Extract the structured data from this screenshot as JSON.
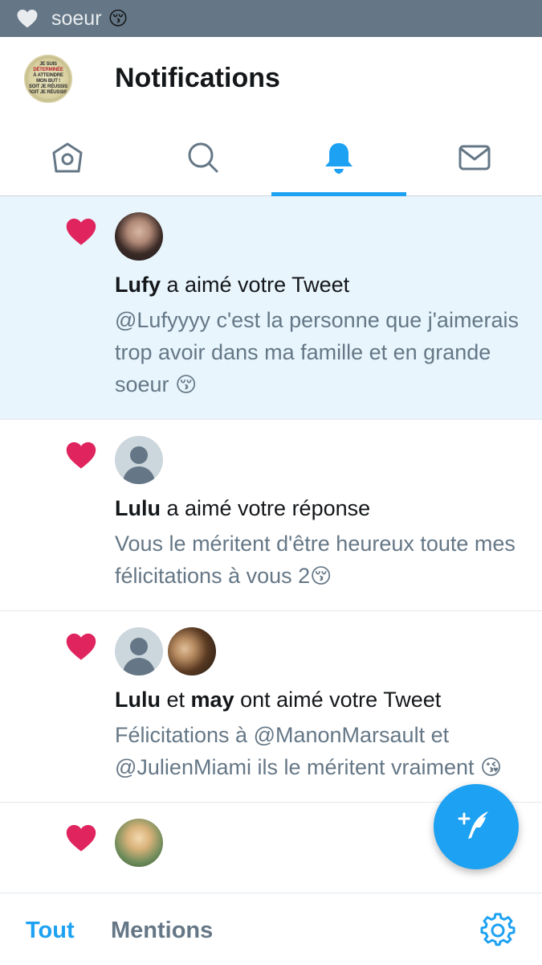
{
  "status_bar": {
    "notification_text": "soeur",
    "notification_emoji": "😚",
    "background": "#657786"
  },
  "header": {
    "title": "Notifications",
    "avatar_text": [
      "JE SUIS",
      "DÉTERMINÉE",
      "À ATTEINDRE",
      "MON BUT !",
      "SOIT JE RÉUSSIS",
      "SOIT JE RÉUSSIS."
    ]
  },
  "tabs": [
    {
      "icon": "home-icon",
      "active": false
    },
    {
      "icon": "search-icon",
      "active": false
    },
    {
      "icon": "bell-icon",
      "active": true
    },
    {
      "icon": "mail-icon",
      "active": false
    }
  ],
  "notifications": [
    {
      "highlighted": true,
      "users": [
        "Lufy"
      ],
      "action": "a aimé votre Tweet",
      "text": "@Lufyyyy c'est la personne que j'aimerais trop avoir dans ma famille et en grande soeur",
      "emoji": "😚"
    },
    {
      "highlighted": false,
      "users": [
        "Lulu"
      ],
      "action": "a aimé votre réponse",
      "text": "Vous le méritent d'être heureux toute mes félicitations à vous 2",
      "emoji": "😚"
    },
    {
      "highlighted": false,
      "users": [
        "Lulu",
        "may"
      ],
      "conjunction": "et",
      "action": "ont aimé votre Tweet",
      "text": "Félicitations à @ManonMarsault et @JulienMiami ils le méritent vraiment",
      "emoji": "😘"
    }
  ],
  "bottom_bar": {
    "tout_label": "Tout",
    "mentions_label": "Mentions",
    "settings_icon": "gear-icon"
  },
  "colors": {
    "accent": "#1da1f2",
    "like": "#e0245e",
    "highlight_bg": "#e8f5fd",
    "secondary_text": "#657786"
  }
}
